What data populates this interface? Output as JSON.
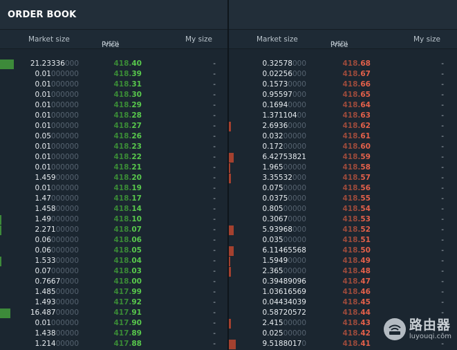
{
  "left": {
    "title": "ORDER BOOK",
    "columns": {
      "market_size": "Market size",
      "price": "Price",
      "price_unit": "(USD)",
      "my_size": "My size"
    },
    "rows": [
      {
        "size_sig": "21.23336",
        "size_pad": "000",
        "price_base": "418.",
        "price_hi": "40",
        "my": "-",
        "depth": 0.06
      },
      {
        "size_sig": "0.01",
        "size_pad": "000000",
        "price_base": "418.",
        "price_hi": "39",
        "my": "-",
        "depth": 0
      },
      {
        "size_sig": "0.01",
        "size_pad": "000000",
        "price_base": "418.",
        "price_hi": "31",
        "my": "-",
        "depth": 0
      },
      {
        "size_sig": "0.01",
        "size_pad": "000000",
        "price_base": "418.",
        "price_hi": "30",
        "my": "-",
        "depth": 0
      },
      {
        "size_sig": "0.01",
        "size_pad": "000000",
        "price_base": "418.",
        "price_hi": "29",
        "my": "-",
        "depth": 0
      },
      {
        "size_sig": "0.01",
        "size_pad": "000000",
        "price_base": "418.",
        "price_hi": "28",
        "my": "-",
        "depth": 0
      },
      {
        "size_sig": "0.01",
        "size_pad": "000000",
        "price_base": "418.",
        "price_hi": "27",
        "my": "-",
        "depth": 0
      },
      {
        "size_sig": "0.05",
        "size_pad": "000000",
        "price_base": "418.",
        "price_hi": "26",
        "my": "-",
        "depth": 0
      },
      {
        "size_sig": "0.01",
        "size_pad": "000000",
        "price_base": "418.",
        "price_hi": "23",
        "my": "-",
        "depth": 0
      },
      {
        "size_sig": "0.01",
        "size_pad": "000000",
        "price_base": "418.",
        "price_hi": "22",
        "my": "-",
        "depth": 0
      },
      {
        "size_sig": "0.01",
        "size_pad": "000000",
        "price_base": "418.",
        "price_hi": "21",
        "my": "-",
        "depth": 0
      },
      {
        "size_sig": "1.459",
        "size_pad": "00000",
        "price_base": "418.",
        "price_hi": "20",
        "my": "-",
        "depth": 0
      },
      {
        "size_sig": "0.01",
        "size_pad": "000000",
        "price_base": "418.",
        "price_hi": "19",
        "my": "-",
        "depth": 0
      },
      {
        "size_sig": "1.47",
        "size_pad": "000000",
        "price_base": "418.",
        "price_hi": "17",
        "my": "-",
        "depth": 0
      },
      {
        "size_sig": "1.458",
        "size_pad": "00000",
        "price_base": "418.",
        "price_hi": "14",
        "my": "-",
        "depth": 0
      },
      {
        "size_sig": "1.49",
        "size_pad": "000000",
        "price_base": "418.",
        "price_hi": "10",
        "my": "-",
        "depth": 0.005
      },
      {
        "size_sig": "2.271",
        "size_pad": "00000",
        "price_base": "418.",
        "price_hi": "07",
        "my": "-",
        "depth": 0.005
      },
      {
        "size_sig": "0.06",
        "size_pad": "000000",
        "price_base": "418.",
        "price_hi": "06",
        "my": "-",
        "depth": 0
      },
      {
        "size_sig": "0.06",
        "size_pad": "000000",
        "price_base": "418.",
        "price_hi": "05",
        "my": "-",
        "depth": 0
      },
      {
        "size_sig": "1.533",
        "size_pad": "00000",
        "price_base": "418.",
        "price_hi": "04",
        "my": "-",
        "depth": 0.005
      },
      {
        "size_sig": "0.07",
        "size_pad": "000000",
        "price_base": "418.",
        "price_hi": "03",
        "my": "-",
        "depth": 0
      },
      {
        "size_sig": "0.7667",
        "size_pad": "0000",
        "price_base": "418.",
        "price_hi": "00",
        "my": "-",
        "depth": 0
      },
      {
        "size_sig": "1.485",
        "size_pad": "00000",
        "price_base": "417.",
        "price_hi": "99",
        "my": "-",
        "depth": 0
      },
      {
        "size_sig": "1.493",
        "size_pad": "00000",
        "price_base": "417.",
        "price_hi": "92",
        "my": "-",
        "depth": 0
      },
      {
        "size_sig": "16.487",
        "size_pad": "00000",
        "price_base": "417.",
        "price_hi": "91",
        "my": "-",
        "depth": 0.045
      },
      {
        "size_sig": "0.01",
        "size_pad": "000000",
        "price_base": "417.",
        "price_hi": "90",
        "my": "-",
        "depth": 0
      },
      {
        "size_sig": "1.438",
        "size_pad": "00000",
        "price_base": "417.",
        "price_hi": "89",
        "my": "-",
        "depth": 0
      },
      {
        "size_sig": "1.214",
        "size_pad": "00000",
        "price_base": "417.",
        "price_hi": "88",
        "my": "-",
        "depth": 0
      }
    ]
  },
  "right": {
    "columns": {
      "market_size": "Market size",
      "price": "Price",
      "price_unit": "(USD)",
      "my_size": "My size"
    },
    "rows": [
      {
        "size_sig": "0.32578",
        "size_pad": "000",
        "price_base": "418.",
        "price_hi": "68",
        "my": "-",
        "depth": 0
      },
      {
        "size_sig": "0.02256",
        "size_pad": "000",
        "price_base": "418.",
        "price_hi": "67",
        "my": "-",
        "depth": 0
      },
      {
        "size_sig": "0.1573",
        "size_pad": "0000",
        "price_base": "418.",
        "price_hi": "66",
        "my": "-",
        "depth": 0
      },
      {
        "size_sig": "0.95597",
        "size_pad": "000",
        "price_base": "418.",
        "price_hi": "65",
        "my": "-",
        "depth": 0
      },
      {
        "size_sig": "0.1694",
        "size_pad": "0000",
        "price_base": "418.",
        "price_hi": "64",
        "my": "-",
        "depth": 0
      },
      {
        "size_sig": "1.371104",
        "size_pad": "00",
        "price_base": "418.",
        "price_hi": "63",
        "my": "-",
        "depth": 0
      },
      {
        "size_sig": "2.6936",
        "size_pad": "0000",
        "price_base": "418.",
        "price_hi": "62",
        "my": "-",
        "depth": 0.01
      },
      {
        "size_sig": "0.032",
        "size_pad": "00000",
        "price_base": "418.",
        "price_hi": "61",
        "my": "-",
        "depth": 0
      },
      {
        "size_sig": "0.172",
        "size_pad": "00000",
        "price_base": "418.",
        "price_hi": "60",
        "my": "-",
        "depth": 0
      },
      {
        "size_sig": "6.42753821",
        "size_pad": "",
        "price_base": "418.",
        "price_hi": "59",
        "my": "-",
        "depth": 0.02
      },
      {
        "size_sig": "1.965",
        "size_pad": "00000",
        "price_base": "418.",
        "price_hi": "58",
        "my": "-",
        "depth": 0.005
      },
      {
        "size_sig": "3.35532",
        "size_pad": "000",
        "price_base": "418.",
        "price_hi": "57",
        "my": "-",
        "depth": 0.01
      },
      {
        "size_sig": "0.075",
        "size_pad": "00000",
        "price_base": "418.",
        "price_hi": "56",
        "my": "-",
        "depth": 0
      },
      {
        "size_sig": "0.0375",
        "size_pad": "0000",
        "price_base": "418.",
        "price_hi": "55",
        "my": "-",
        "depth": 0
      },
      {
        "size_sig": "0.805",
        "size_pad": "00000",
        "price_base": "418.",
        "price_hi": "54",
        "my": "-",
        "depth": 0
      },
      {
        "size_sig": "0.3067",
        "size_pad": "0000",
        "price_base": "418.",
        "price_hi": "53",
        "my": "-",
        "depth": 0
      },
      {
        "size_sig": "5.93968",
        "size_pad": "000",
        "price_base": "418.",
        "price_hi": "52",
        "my": "-",
        "depth": 0.02
      },
      {
        "size_sig": "0.035",
        "size_pad": "00000",
        "price_base": "418.",
        "price_hi": "51",
        "my": "-",
        "depth": 0
      },
      {
        "size_sig": "6.11465568",
        "size_pad": "",
        "price_base": "418.",
        "price_hi": "50",
        "my": "-",
        "depth": 0.02
      },
      {
        "size_sig": "1.5949",
        "size_pad": "0000",
        "price_base": "418.",
        "price_hi": "49",
        "my": "-",
        "depth": 0.005
      },
      {
        "size_sig": "2.365",
        "size_pad": "00000",
        "price_base": "418.",
        "price_hi": "48",
        "my": "-",
        "depth": 0.01
      },
      {
        "size_sig": "0.39489096",
        "size_pad": "",
        "price_base": "418.",
        "price_hi": "47",
        "my": "-",
        "depth": 0
      },
      {
        "size_sig": "1.03616569",
        "size_pad": "",
        "price_base": "418.",
        "price_hi": "46",
        "my": "-",
        "depth": 0
      },
      {
        "size_sig": "0.04434039",
        "size_pad": "",
        "price_base": "418.",
        "price_hi": "45",
        "my": "-",
        "depth": 0
      },
      {
        "size_sig": "0.58720572",
        "size_pad": "",
        "price_base": "418.",
        "price_hi": "44",
        "my": "-",
        "depth": 0
      },
      {
        "size_sig": "2.415",
        "size_pad": "00000",
        "price_base": "418.",
        "price_hi": "43",
        "my": "-",
        "depth": 0.01
      },
      {
        "size_sig": "0.025",
        "size_pad": "00000",
        "price_base": "418.",
        "price_hi": "42",
        "my": "-",
        "depth": 0
      },
      {
        "size_sig": "9.5188017",
        "size_pad": "0",
        "price_base": "418.",
        "price_hi": "41",
        "my": "-",
        "depth": 0.03
      }
    ]
  },
  "watermark": {
    "cn": "路由器",
    "en": "luyouqi.com"
  },
  "colors": {
    "background": "#1b2630",
    "bid_price": "#58c84c",
    "ask_price": "#e3604a",
    "bid_depth": "#3d8a3a",
    "ask_depth": "#a4412f"
  }
}
